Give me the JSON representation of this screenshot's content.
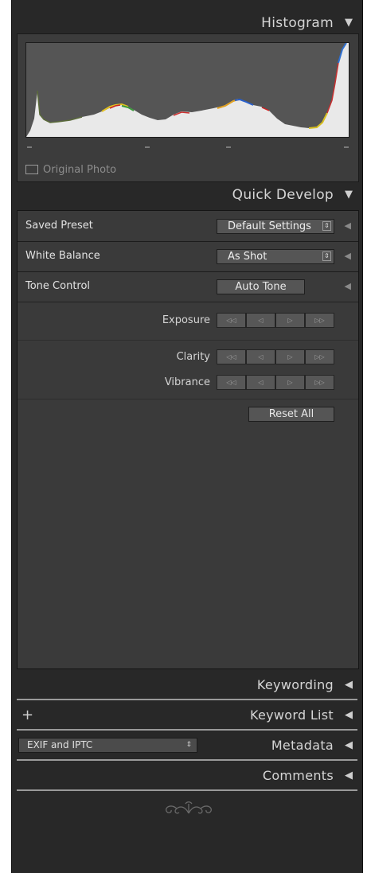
{
  "histogram": {
    "title": "Histogram",
    "original_photo_label": "Original Photo"
  },
  "quick_develop": {
    "title": "Quick Develop",
    "saved_preset": {
      "label": "Saved Preset",
      "value": "Default Settings"
    },
    "white_balance": {
      "label": "White Balance",
      "value": "As Shot"
    },
    "tone_control": {
      "label": "Tone Control",
      "auto_tone_label": "Auto Tone"
    },
    "exposure_label": "Exposure",
    "clarity_label": "Clarity",
    "vibrance_label": "Vibrance",
    "reset_all_label": "Reset All"
  },
  "panels": {
    "keywording": "Keywording",
    "keyword_list": "Keyword List",
    "metadata": "Metadata",
    "metadata_preset": "EXIF and IPTC",
    "comments": "Comments"
  },
  "colors": {
    "panel_bg": "#282828",
    "section_bg": "#3a3a3a",
    "header_text": "#d6d6d6"
  }
}
